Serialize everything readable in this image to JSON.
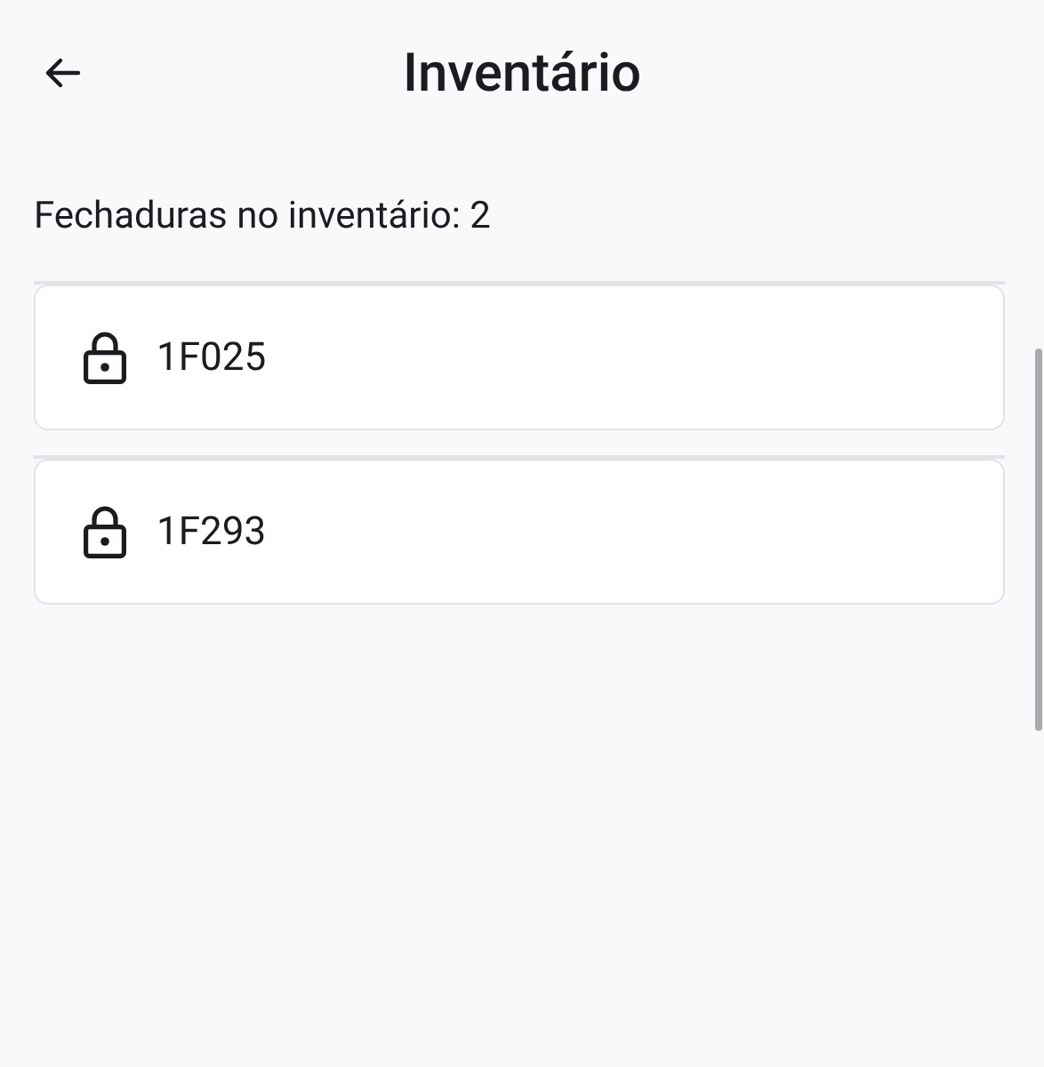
{
  "header": {
    "title": "Inventário"
  },
  "summary": "Fechaduras no inventário: 2",
  "locks": [
    {
      "code": "1F025"
    },
    {
      "code": "1F293"
    }
  ]
}
